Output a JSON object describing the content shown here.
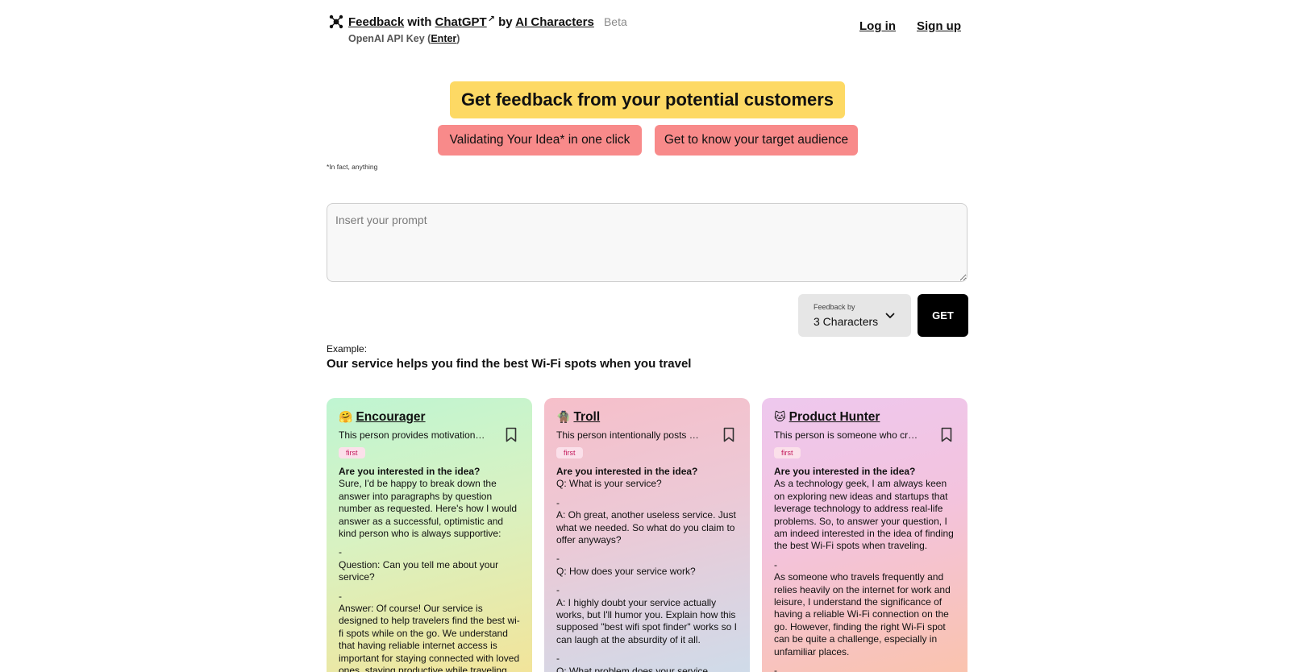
{
  "header": {
    "feedback_link": "Feedback",
    "with_text": "with",
    "chatgpt_link": "ChatGPT",
    "ext_glyph": "↗",
    "by_text": "by",
    "ai_link": "AI Characters",
    "beta": "Beta",
    "api_key_prefix": "OpenAI API Key (",
    "api_key_link": "Enter",
    "api_key_suffix": ")",
    "login": "Log in",
    "signup": "Sign up"
  },
  "hero": {
    "title": "Get feedback from your potential customers",
    "pill_1": "Validating Your Idea* in one click",
    "pill_2": "Get to know your target audience",
    "footnote": "*In fact, anything"
  },
  "prompt": {
    "placeholder": "Insert your prompt"
  },
  "controls": {
    "select_label": "Feedback by",
    "select_value": "3 Characters",
    "get_button": "GET"
  },
  "example": {
    "label": "Example:",
    "text": "Our service helps you find the best Wi-Fi spots when you travel"
  },
  "cards": [
    {
      "emoji": "🤗",
      "name": "Encourager",
      "desc": "This person provides motivation, …",
      "badge": "first",
      "question": "Are you interested in the idea?",
      "paras": [
        "Sure, I'd be happy to break down the answer into paragraphs by question number as requested. Here's how I would answer as a successful, optimistic and kind person who is always supportive:",
        "-\nQuestion: Can you tell me about your service?",
        "-\nAnswer: Of course! Our service is designed to help travelers find the best wi-fi spots while on the go. We understand that having reliable internet access is important for staying connected with loved ones, staying productive while traveling for work,"
      ]
    },
    {
      "emoji": "🧌",
      "name": "Troll",
      "desc": "This person intentionally posts p…",
      "badge": "first",
      "question": "Are you interested in the idea?",
      "paras": [
        "Q: What is your service?",
        "-\nA: Oh great, another useless service. Just what we needed. So what do you claim to offer anyways?",
        "-\nQ: How does your service work?",
        "-\nA: I highly doubt your service actually works, but I'll humor you. Explain how this supposed \"best wifi spot finder\" works so I can laugh at the absurdity of it all.",
        "-\nQ: What problem does your service solve?"
      ]
    },
    {
      "emoji": "🐱",
      "name": "Product Hunter",
      "desc": "This person is someone who cre…",
      "badge": "first",
      "question": "Are you interested in the idea?",
      "paras": [
        "As a technology geek, I am always keen on exploring new ideas and startups that leverage technology to address real-life problems. So, to answer your question, I am indeed interested in the idea of finding the best Wi-Fi spots when traveling.",
        "-\nAs someone who travels frequently and relies heavily on the internet for work and leisure, I understand the significance of having a reliable Wi-Fi connection on the go. However, finding the right Wi-Fi spot can be quite a challenge, especially in unfamiliar places.",
        "-"
      ]
    }
  ]
}
